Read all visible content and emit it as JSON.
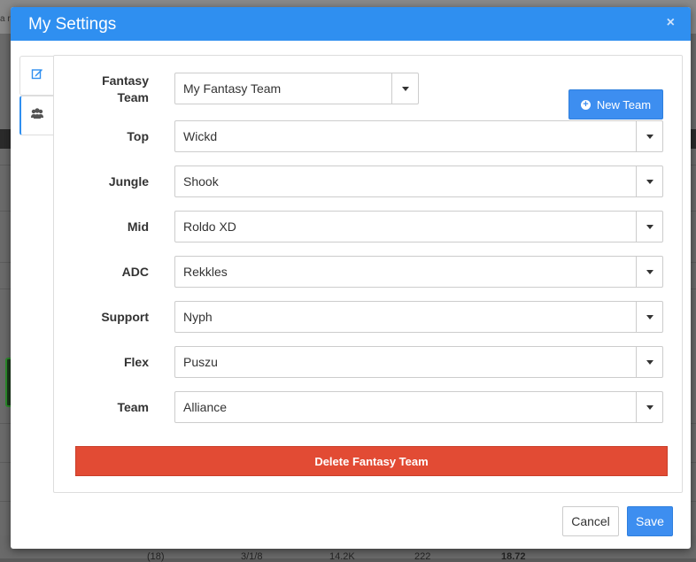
{
  "background": {
    "fragment_text": "a re",
    "bottom_cells": [
      "(18)",
      "3/1/8",
      "14.2K",
      "222",
      "18.72"
    ]
  },
  "modal": {
    "title": "My Settings",
    "close_glyph": "×"
  },
  "tabs": [
    {
      "name": "edit",
      "icon": "edit-icon"
    },
    {
      "name": "team",
      "icon": "users-icon"
    }
  ],
  "form": {
    "fantasy_team": {
      "label": "Fantasy\nTeam",
      "label_line1": "Fantasy",
      "label_line2": "Team",
      "value": "My Fantasy Team"
    },
    "new_team_label": "New Team",
    "fields": [
      {
        "label": "Top",
        "value": "Wickd"
      },
      {
        "label": "Jungle",
        "value": "Shook"
      },
      {
        "label": "Mid",
        "value": "Roldo XD"
      },
      {
        "label": "ADC",
        "value": "Rekkles"
      },
      {
        "label": "Support",
        "value": "Nyph"
      },
      {
        "label": "Flex",
        "value": "Puszu"
      },
      {
        "label": "Team",
        "value": "Alliance"
      }
    ],
    "delete_label": "Delete Fantasy Team"
  },
  "footer": {
    "cancel_label": "Cancel",
    "save_label": "Save"
  },
  "colors": {
    "header": "#2f8ff0",
    "primary": "#3d8ef0",
    "danger": "#e24b34"
  }
}
